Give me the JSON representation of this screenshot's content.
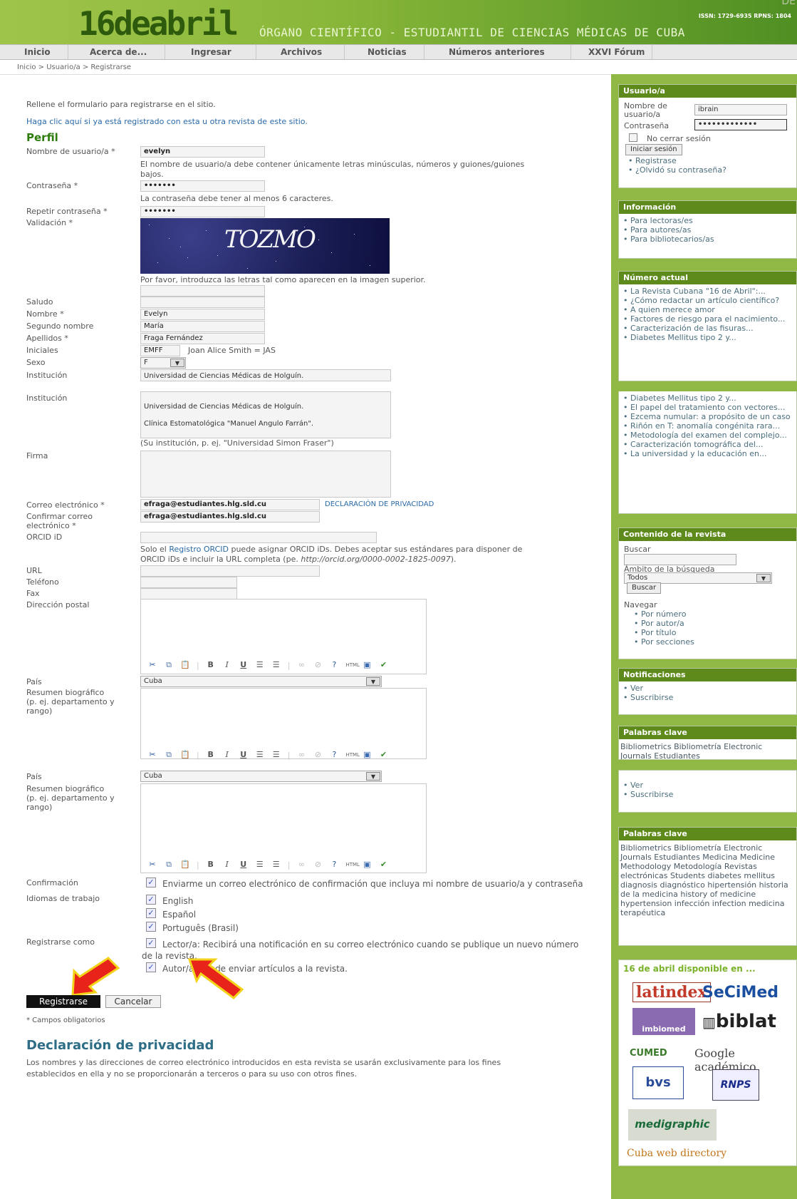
{
  "header": {
    "logo": "16deabril",
    "org": "ÓRGANO CIENTÍFICO - ESTUDIANTIL DE CIENCIAS MÉDICAS DE CUBA",
    "issn": "ISSN: 1729-6935   RPNS: 1804",
    "corner_glyph": "DE"
  },
  "nav": [
    "Inicio",
    "Acerca de...",
    "Ingresar",
    "Archivos",
    "Noticias",
    "Números anteriores",
    "XXVI Fórum"
  ],
  "breadcrumb": "Inicio > Usuario/a > Registrarse",
  "form": {
    "intro": "Rellene el formulario para registrarse en el sitio.",
    "already": "Haga clic aquí si ya está registrado con esta u otra revista de este sitio.",
    "section_title": "Perfil",
    "username_label": "Nombre de usuario/a *",
    "username": "evelyn",
    "username_help_1": "El nombre de usuario/a debe contener únicamente letras minúsculas, números y guiones/guiones",
    "username_help_2": "bajos.",
    "password_label": "Contraseña *",
    "password": "•••••••",
    "password_help": "La contraseña debe tener al menos 6 caracteres.",
    "repeat_label": "Repetir contraseña *",
    "repeat": "•••••••",
    "validation_label": "Validación *",
    "captcha_text": "TOZMO",
    "captcha_help": "Por favor, introduzca las letras tal como aparecen en la imagen superior.",
    "greeting_label": "Saludo",
    "name_label": "Nombre *",
    "name": "Evelyn",
    "middle_label": "Segundo nombre",
    "middle": "María",
    "last_label": "Apellidos *",
    "last": "Fraga Fernández",
    "initials_label": "Iniciales",
    "initials": "EMFF",
    "initials_help": "Joan Alice Smith = JAS",
    "sex_label": "Sexo",
    "sex": "F",
    "institution_label": "Institución",
    "institution_line1": "Universidad de Ciencias Médicas de Holguín.",
    "institution_line2": "Clínica Estomatológica \"Manuel Angulo Farrán\".",
    "institution_help": "(Su institución, p. ej. \"Universidad Simon Fraser\")",
    "signature_label": "Firma",
    "email_label": "Correo electrónico *",
    "email": "efraga@estudiantes.hlg.sld.cu",
    "privacy_link": "DECLARACIÓN DE PRIVACIDAD",
    "confirm_email_label_1": "Confirmar correo",
    "confirm_email_label_2": "electrónico *",
    "confirm_email": "efraga@estudiantes.hlg.sld.cu",
    "orcid_label": "ORCID iD",
    "orcid_help_1a": "Solo el ",
    "orcid_help_1b": "Registro ORCID",
    "orcid_help_1c": " puede asignar ORCID iDs. Debes aceptar sus estándares para disponer de",
    "orcid_help_2a": "ORCID iDs e incluir la URL completa (pe. ",
    "orcid_help_2b": "http://orcid.org/0000-0002-1825-0097",
    "orcid_help_2c": ").",
    "url_label": "URL",
    "phone_label": "Teléfono",
    "fax_label": "Fax",
    "postal_label": "Dirección postal",
    "country_label": "País",
    "country": "Cuba",
    "bio_label_1": "Resumen biográfico",
    "bio_label_2": "(p. ej. departamento y",
    "bio_label_3": "rango)",
    "confirm_label": "Confirmación",
    "confirm_text": "Enviarme un correo electrónico de confirmación que incluya mi nombre de usuario/a y contraseña",
    "lang_label": "Idiomas de trabajo",
    "langs": [
      "English",
      "Español",
      "Português (Brasil)"
    ],
    "register_as_label": "Registrarse como",
    "reader_1": "Lector/a: Recibirá una notificación en su correo electrónico cuando se publique un nuevo número",
    "reader_2": "de la revista.",
    "author": "Autor/a: Puede enviar artículos a la revista.",
    "register_button": "Registrarse",
    "cancel_button": "Cancelar",
    "required_note": "* Campos obligatorios",
    "privacy_title": "Declaración de privacidad",
    "privacy_1": "Los nombres y las direcciones de correo electrónico introducidos en esta revista se usarán exclusivamente para los fines",
    "privacy_2": "establecidos en ella y no se proporcionarán a terceros o para su uso con otros fines."
  },
  "sidebar": {
    "user_title": "Usuario/a",
    "user_label_1": "Nombre de",
    "user_label_2": "usuario/a",
    "user_value": "ibrain",
    "pass_label": "Contraseña",
    "pass_value": "•••••••••••••",
    "remember": "No cerrar sesión",
    "login_button": "Iniciar sesión",
    "user_links": [
      "Registrase",
      "¿Olvidó su contraseña?"
    ],
    "info_title": "Información",
    "info_links": [
      "Para lectoras/es",
      "Para autores/as",
      "Para bibliotecarios/as"
    ],
    "current_title": "Número actual",
    "current_1": [
      "La Revista Cubana \"16 de Abril\":...",
      "¿Cómo redactar un artículo científico?",
      "A quien merece amor",
      "Factores de riesgo para el nacimiento...",
      "Caracterización de las fisuras...",
      "Diabetes Mellitus tipo 2 y..."
    ],
    "current_2": [
      "Diabetes Mellitus tipo 2 y...",
      "El papel del tratamiento con vectores...",
      "Ezcema numular: a propósito de un caso",
      "Riñón en T: anomalía congénita rara...",
      "Metodología del examen del complejo...",
      "Caracterización tomográfica del...",
      "La universidad y la educación en..."
    ],
    "content_title": "Contenido de la revista",
    "search_label": "Buscar",
    "scope_label": "Ámbito de la búsqueda",
    "scope_value": "Todos",
    "search_button": "Buscar",
    "browse_label": "Navegar",
    "browse_links": [
      "Por número",
      "Por autor/a",
      "Por título",
      "Por secciones"
    ],
    "notif_title": "Notificaciones",
    "notif_links": [
      "Ver",
      "Suscribirse"
    ],
    "kw_title": "Palabras clave",
    "kw_partial": "Bibliometrics Bibliometría Electronic Journals Estudiantes",
    "kw_full": "Bibliometrics Bibliometría Electronic Journals Estudiantes Medicina Medicine Methodology Metodología Revistas electrónicas Students diabetes mellitus diagnosis diagnóstico hipertensión historia de la medicina history of medicine hypertension infección infection medicina terapéutica",
    "avail_title": "16 de abril disponible en ...",
    "logos": [
      "latindex",
      "SeCiMed",
      "imbiomed",
      "biblat",
      "CUMED",
      "Google académico",
      "bvs",
      "RNPS",
      "medigraphic",
      "Cuba web directory"
    ]
  },
  "colors": {
    "header_green": "#8ab83a",
    "sidebar_green": "#8fb844",
    "block_header": "#5e8a1c",
    "title_green": "#2e7d0c",
    "arrow_red": "#e8231a",
    "arrow_yellow": "#f3d21a"
  },
  "icons": [
    "cut-icon",
    "copy-icon",
    "paste-icon",
    "bold-icon",
    "italic-icon",
    "underline-icon",
    "bullet-list-icon",
    "numbered-list-icon",
    "link-icon",
    "unlink-icon",
    "help-icon",
    "html-icon",
    "image-icon",
    "spellcheck-icon"
  ]
}
